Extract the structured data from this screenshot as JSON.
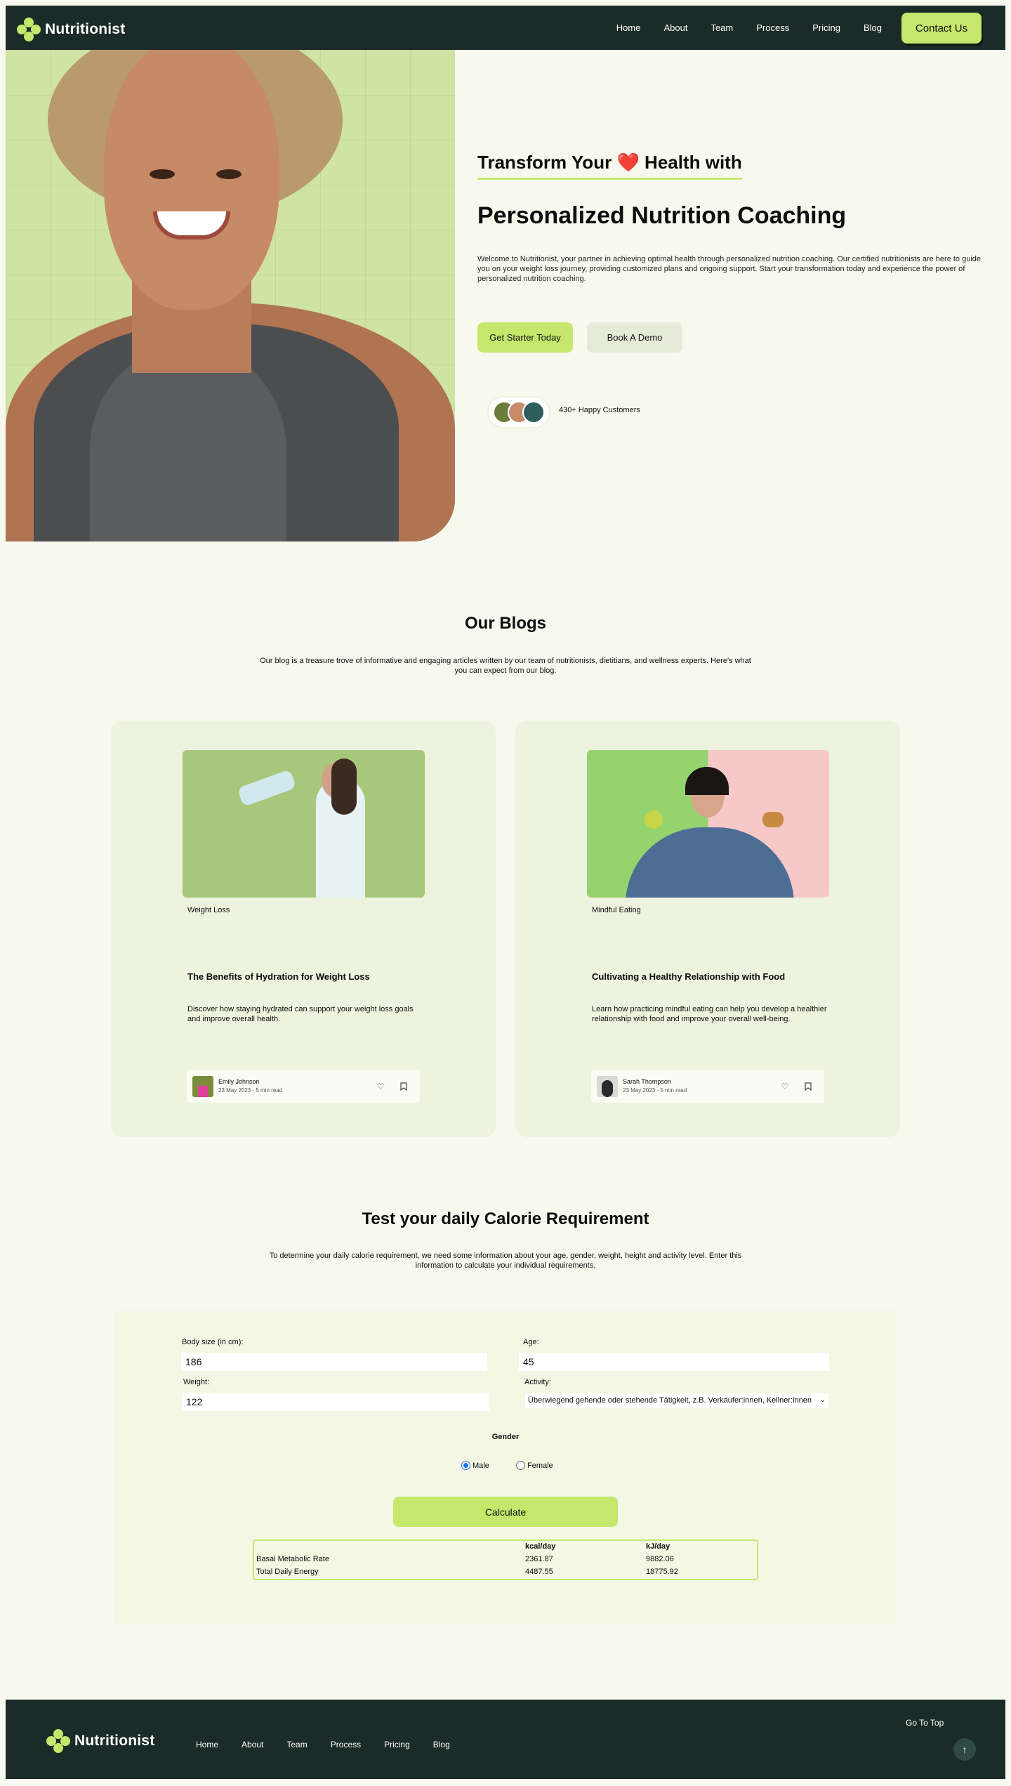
{
  "header": {
    "logo_text": "Nutritionist",
    "nav": [
      "Home",
      "About",
      "Team",
      "Process",
      "Pricing",
      "Blog"
    ],
    "contact_label": "Contact Us"
  },
  "hero": {
    "subtitle_before": "Transform Your",
    "subtitle_emoji": "❤️",
    "subtitle_after": "Health with",
    "title": "Personalized Nutrition Coaching",
    "description": "Welcome to Nutritionist, your partner in achieving optimal health through personalized nutrition coaching. Our certified nutritionists are here to guide you on your weight loss journey, providing customized plans and ongoing support. Start your transformation today and experience the power of personalized nutrition coaching.",
    "cta_primary": "Get Starter Today",
    "cta_secondary": "Book A Demo",
    "customers": "430+ Happy Customers"
  },
  "blogs": {
    "title": "Our Blogs",
    "description": "Our blog is a treasure trove of informative and engaging articles written by our team of nutritionists, dietitians, and wellness experts. Here's what you can expect from our blog.",
    "posts": [
      {
        "category": "Weight Loss",
        "title": "The Benefits of Hydration for Weight Loss",
        "excerpt": "Discover how staying hydrated can support your weight loss goals and improve overall health.",
        "author": "Emily Johnson",
        "meta": "23 May 2023 - 5 min read"
      },
      {
        "category": "Mindful Eating",
        "title": "Cultivating a Healthy Relationship with Food",
        "excerpt": "Learn how practicing mindful eating can help you develop a healthier relationship with food and improve your overall well-being.",
        "author": "Sarah Thompson",
        "meta": "23 May 2023 - 5 min read"
      }
    ]
  },
  "calculator": {
    "title": "Test your daily Calorie Requirement",
    "description": "To determine your daily calorie requirement, we need some information about your age, gender, weight, height and activity level. Enter this information to calculate your individual requirements.",
    "body_size_label": "Body size (in cm):",
    "body_size_value": "186",
    "age_label": "Age:",
    "age_value": "45",
    "weight_label": "Weight:",
    "weight_value": "122",
    "activity_label": "Activity:",
    "activity_value": "Überwiegend gehende oder stehende Tätigkeit, z.B. Verkäufer:innen, Kellner:innen",
    "gender_label": "Gender",
    "gender_options": [
      "Male",
      "Female"
    ],
    "gender_selected": "Male",
    "calculate_label": "Calculate",
    "result_headers": [
      "kcal/day",
      "kJ/day"
    ],
    "results": [
      {
        "label": "Basal Metabolic Rate",
        "kcal": "2361.87",
        "kj": "9882.06"
      },
      {
        "label": "Total Daily Energy",
        "kcal": "4487.55",
        "kj": "18775.92"
      }
    ]
  },
  "footer": {
    "logo_text": "Nutritionist",
    "nav": [
      "Home",
      "About",
      "Team",
      "Process",
      "Pricing",
      "Blog"
    ],
    "go_to_top": "Go To Top"
  },
  "colors": {
    "brand_dark": "#1b2b27",
    "accent": "#c5e86c",
    "page_bg": "#f7f9ee"
  }
}
